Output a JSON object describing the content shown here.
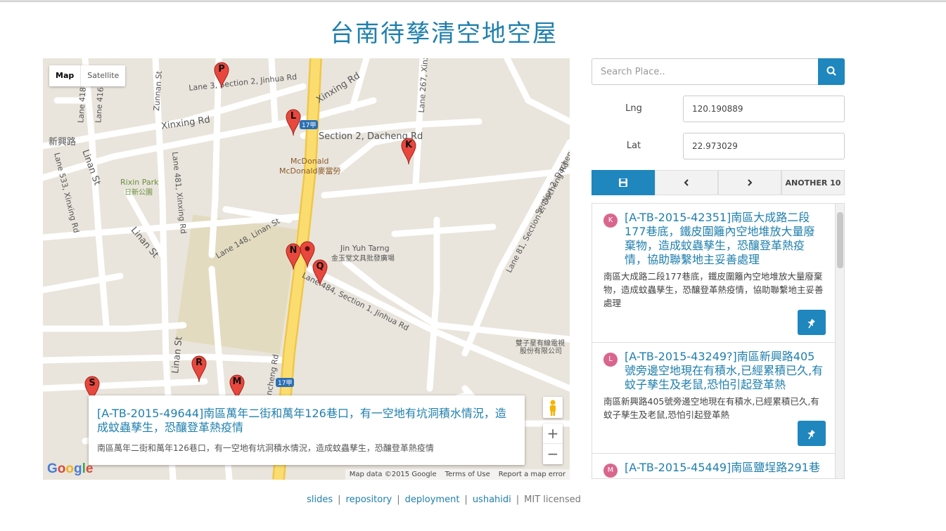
{
  "page": {
    "title": "台南待孳清空地空屋"
  },
  "map": {
    "type_buttons": {
      "map": "Map",
      "satellite": "Satellite"
    },
    "street_labels": {
      "lane3": "Lane 3, Section 2, Jinhua Rd",
      "xinxing1": "Xinxing Rd",
      "xinxing2": "Xinxing Rd",
      "sec2dacheng": "Section 2, Dacheng Rd",
      "xinxing_zh": "新興路",
      "mcd1": "McDonald",
      "mcd2": "McDonald麥當勞",
      "rixin": "Rixin Park",
      "rixin_zh": "日新公園",
      "linan1": "Linan St",
      "linan2": "Linan St",
      "linan3": "Linan St",
      "lane148": "Lane 148, Linan St",
      "lane533": "Lane 533, Xinxing Rd",
      "lane481": "Lane 481, Xinxing Rd",
      "lane418": "Lane 418",
      "lane416": "Lane 416",
      "zunnan": "Zunnan St",
      "lane267": "Lane 267, Xinx",
      "lane81": "Lane 81, Section 2, Dacheng Rd",
      "sec2dacheng2": "Section 2, Dacheng Rd",
      "jinyu1": "Jin Yuh Tarng",
      "jinyu2": "金玉堂文具批發廣場",
      "lane484": "Lane 484, Section 1, Jinhua Rd",
      "yancheng": "Yancheng Rd",
      "cable1": "雙子星有線電視",
      "cable2": "股份有限公司",
      "route1": "17甲",
      "route2": "17甲"
    },
    "markers": [
      "P",
      "L",
      "K",
      "N",
      "Q",
      "R",
      "M",
      "S"
    ],
    "infowindow": {
      "title": "[A-TB-2015-49644]南區萬年二街和萬年126巷口，有一空地有坑洞積水情況，造成蚊蟲孳生，恐釀登革熱疫情",
      "desc": "南區萬年二街和萬年126巷口，有一空地有坑洞積水情況，造成蚊蟲孳生，恐釀登革熱疫情"
    },
    "zoom_in": "+",
    "zoom_out": "−",
    "google": "Google",
    "attribution": {
      "data": "Map data ©2015 Google",
      "terms": "Terms of Use",
      "report": "Report a map error"
    }
  },
  "search": {
    "placeholder": "Search Place.."
  },
  "coords": {
    "lng_label": "Lng",
    "lng_value": "120.190889",
    "lat_label": "Lat",
    "lat_value": "22.973029"
  },
  "buttons": {
    "another": "ANOTHER 10"
  },
  "items": [
    {
      "badge": "K",
      "title": "[A-TB-2015-42351]南區大成路二段177巷底，鐵皮圍籬內空地堆放大量廢棄物，造成蚊蟲孳生，恐釀登革熱疫情，協助聯繫地主妥善處理",
      "desc": "南區大成路二段177巷底，鐵皮圍籬內空地堆放大量廢棄物，造成蚊蟲孳生，恐釀登革熱疫情，協助聯繫地主妥善處理"
    },
    {
      "badge": "L",
      "title": "[A-TB-2015-43249?]南區新興路405號旁邊空地現在有積水,已經累積已久,有蚊子孳生及老鼠,恐怕引起登革熱",
      "desc": "南區新興路405號旁邊空地現在有積水,已經累積已久,有蚊子孳生及老鼠,恐怕引起登革熱"
    },
    {
      "badge": "M",
      "title": "[A-TB-2015-45449]南區鹽埕路291巷",
      "desc": ""
    }
  ],
  "footer": {
    "links": [
      "slides",
      "repository",
      "deployment",
      "ushahidi"
    ],
    "license": "MIT licensed"
  },
  "colors": {
    "accent": "#1f86be",
    "title": "#1f7fad",
    "marker": "#e8473d",
    "badge": "#d9668d",
    "highway": "#f9d76b"
  }
}
